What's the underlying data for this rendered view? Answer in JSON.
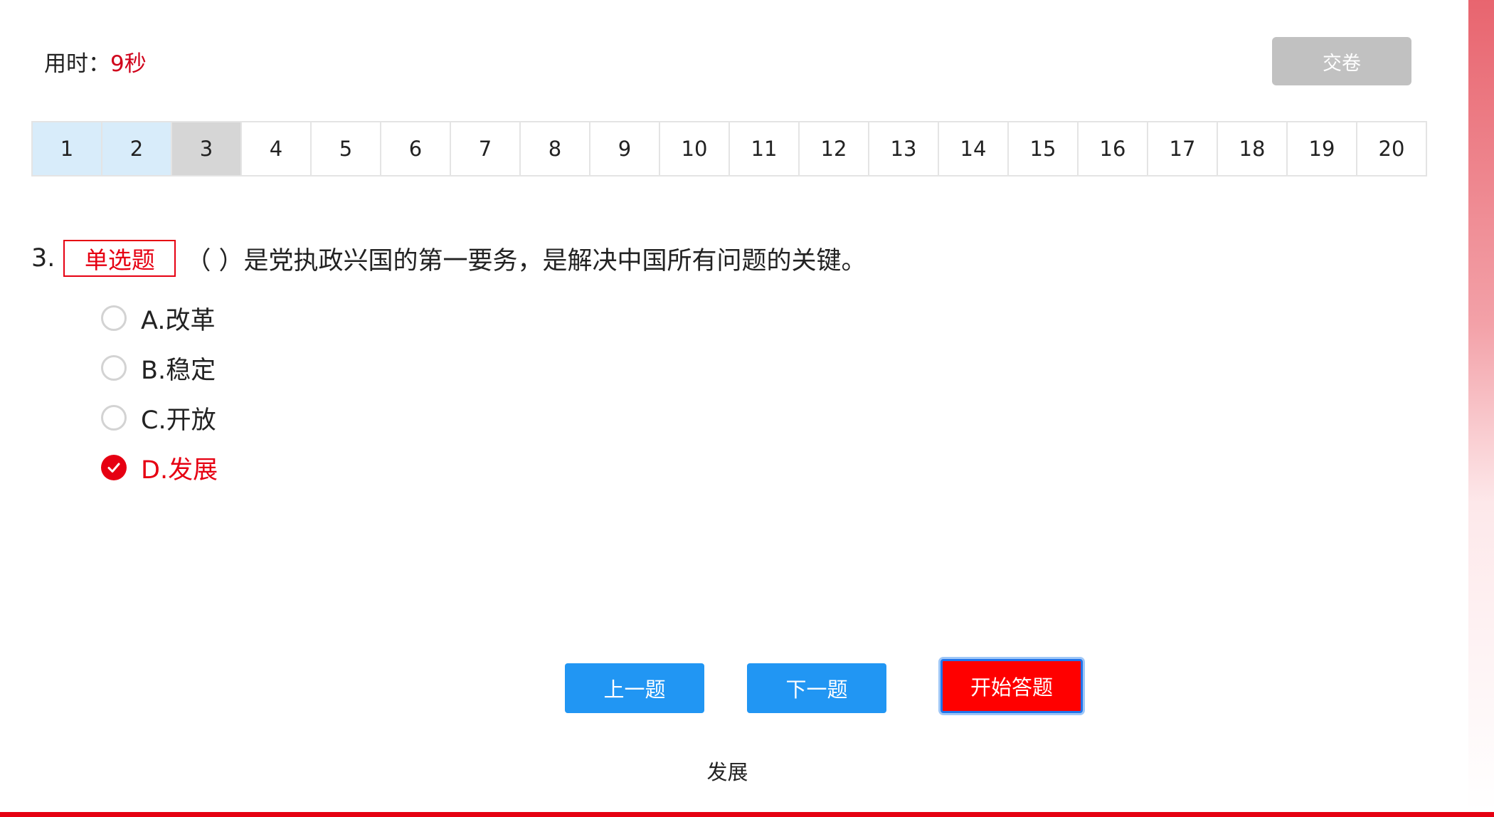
{
  "header": {
    "timer_label": "用时：",
    "timer_value": "9秒",
    "submit_label": "交卷"
  },
  "question_nav": [
    {
      "label": "1",
      "state": "answered"
    },
    {
      "label": "2",
      "state": "answered"
    },
    {
      "label": "3",
      "state": "current"
    },
    {
      "label": "4",
      "state": "unanswered"
    },
    {
      "label": "5",
      "state": "unanswered"
    },
    {
      "label": "6",
      "state": "unanswered"
    },
    {
      "label": "7",
      "state": "unanswered"
    },
    {
      "label": "8",
      "state": "unanswered"
    },
    {
      "label": "9",
      "state": "unanswered"
    },
    {
      "label": "10",
      "state": "unanswered"
    },
    {
      "label": "11",
      "state": "unanswered"
    },
    {
      "label": "12",
      "state": "unanswered"
    },
    {
      "label": "13",
      "state": "unanswered"
    },
    {
      "label": "14",
      "state": "unanswered"
    },
    {
      "label": "15",
      "state": "unanswered"
    },
    {
      "label": "16",
      "state": "unanswered"
    },
    {
      "label": "17",
      "state": "unanswered"
    },
    {
      "label": "18",
      "state": "unanswered"
    },
    {
      "label": "19",
      "state": "unanswered"
    },
    {
      "label": "20",
      "state": "unanswered"
    }
  ],
  "question": {
    "number": "3.",
    "type_label": "单选题",
    "text": "（ ）是党执政兴国的第一要务，是解决中国所有问题的关键。",
    "options": [
      {
        "label": "A.改革",
        "selected": false
      },
      {
        "label": "B.稳定",
        "selected": false
      },
      {
        "label": "C.开放",
        "selected": false
      },
      {
        "label": "D.发展",
        "selected": true
      }
    ]
  },
  "footer": {
    "prev_label": "上一题",
    "next_label": "下一题",
    "start_label": "开始答题",
    "answer_text": "发展"
  },
  "colors": {
    "accent_red": "#e60012",
    "primary_blue": "#2196f3",
    "answered_bg": "#d8ecfa",
    "current_bg": "#d6d6d6",
    "disabled_gray": "#c1c1c1"
  }
}
